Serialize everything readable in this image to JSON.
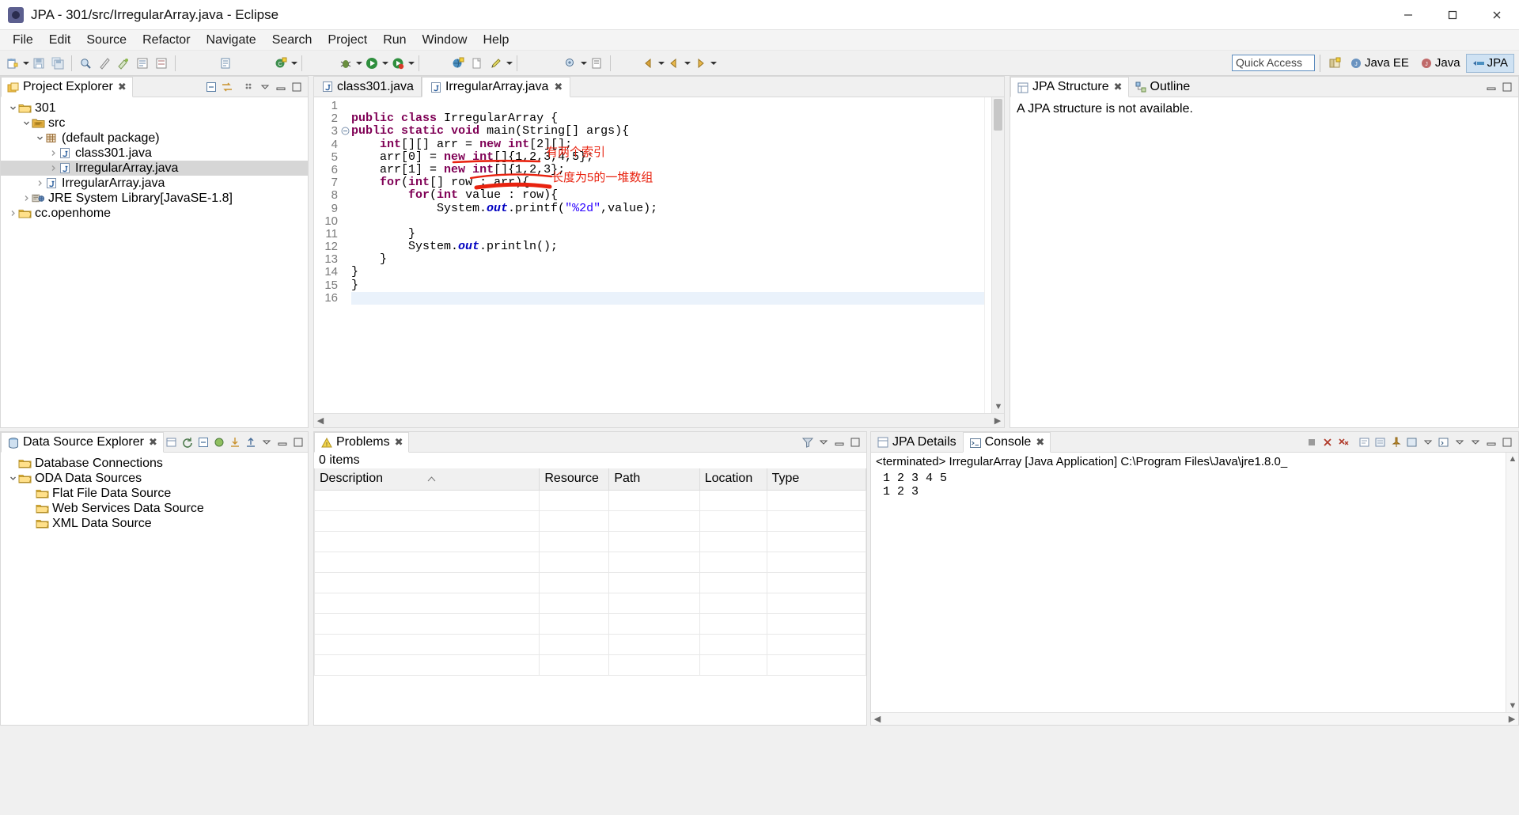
{
  "window": {
    "title": "JPA - 301/src/IrregularArray.java - Eclipse",
    "icon": "eclipse-icon",
    "controls": {
      "minimize": "—",
      "maximize": "❐",
      "close": "✕"
    }
  },
  "menu": [
    "File",
    "Edit",
    "Source",
    "Refactor",
    "Navigate",
    "Search",
    "Project",
    "Run",
    "Window",
    "Help"
  ],
  "toolbar": {
    "quick_access_placeholder": "Quick Access",
    "quick_access_value": "Quick Access",
    "perspectives": [
      {
        "label": "Java EE",
        "icon": "java-ee-perspective-icon",
        "active": false
      },
      {
        "label": "Java",
        "icon": "java-perspective-icon",
        "active": false
      },
      {
        "label": "JPA",
        "icon": "jpa-perspective-icon",
        "active": true
      }
    ],
    "open_perspective_icon": "open-perspective-icon"
  },
  "project_explorer": {
    "tab_label": "Project Explorer",
    "tab_icon": "project-explorer-icon",
    "tools": [
      "collapse-all-icon",
      "link-with-editor-icon",
      "view-menu-icon",
      "minimize-icon",
      "maximize-icon"
    ],
    "tree": [
      {
        "label": "301",
        "icon": "project-icon",
        "indent": 0,
        "expanded": true,
        "has_arrow": true,
        "selected": false
      },
      {
        "label": "src",
        "icon": "source-folder-icon",
        "indent": 1,
        "expanded": true,
        "has_arrow": true,
        "selected": false
      },
      {
        "label": "(default package)",
        "icon": "package-icon",
        "indent": 2,
        "expanded": true,
        "has_arrow": true,
        "selected": false
      },
      {
        "label": "class301.java",
        "icon": "java-file-icon",
        "indent": 3,
        "expanded": false,
        "has_arrow": true,
        "selected": false
      },
      {
        "label": "IrregularArray.java",
        "icon": "java-file-icon",
        "indent": 3,
        "expanded": false,
        "has_arrow": true,
        "selected": true
      },
      {
        "label": "IrregularArray.java",
        "icon": "java-file-icon",
        "indent": 2,
        "expanded": false,
        "has_arrow": true,
        "selected": false
      },
      {
        "label": "JRE System Library",
        "suffix": " [JavaSE-1.8]",
        "icon": "library-icon",
        "indent": 1,
        "expanded": false,
        "has_arrow": true,
        "selected": false
      },
      {
        "label": "cc.openhome",
        "icon": "project-icon",
        "indent": 0,
        "expanded": false,
        "has_arrow": true,
        "selected": false
      }
    ]
  },
  "editor": {
    "tabs": [
      {
        "label": "class301.java",
        "icon": "java-file-icon",
        "active": false,
        "closable": false
      },
      {
        "label": "IrregularArray.java",
        "icon": "java-file-icon",
        "active": true,
        "closable": true
      }
    ],
    "current_line": 16,
    "lines": [
      {
        "n": 1,
        "tokens": []
      },
      {
        "n": 2,
        "tokens": [
          {
            "t": "public",
            "c": "kw"
          },
          {
            "t": " ",
            "c": ""
          },
          {
            "t": "class",
            "c": "kw"
          },
          {
            "t": " IrregularArray {",
            "c": ""
          }
        ]
      },
      {
        "n": 3,
        "fold": true,
        "tokens": [
          {
            "t": "public",
            "c": "kw"
          },
          {
            "t": " ",
            "c": ""
          },
          {
            "t": "static",
            "c": "kw"
          },
          {
            "t": " ",
            "c": ""
          },
          {
            "t": "void",
            "c": "kw"
          },
          {
            "t": " main(String[] args){",
            "c": ""
          }
        ]
      },
      {
        "n": 4,
        "tokens": [
          {
            "t": "    ",
            "c": ""
          },
          {
            "t": "int",
            "c": "kw"
          },
          {
            "t": "[][] arr = ",
            "c": ""
          },
          {
            "t": "new",
            "c": "kw"
          },
          {
            "t": " ",
            "c": ""
          },
          {
            "t": "int",
            "c": "kw"
          },
          {
            "t": "[2][];",
            "c": ""
          }
        ]
      },
      {
        "n": 5,
        "tokens": [
          {
            "t": "    arr[0] = ",
            "c": ""
          },
          {
            "t": "new",
            "c": "kw"
          },
          {
            "t": " ",
            "c": ""
          },
          {
            "t": "int",
            "c": "kw"
          },
          {
            "t": "[]{1,2,3,4,5};",
            "c": ""
          }
        ]
      },
      {
        "n": 6,
        "tokens": [
          {
            "t": "    arr[1] = ",
            "c": ""
          },
          {
            "t": "new",
            "c": "kw"
          },
          {
            "t": " ",
            "c": ""
          },
          {
            "t": "int",
            "c": "kw"
          },
          {
            "t": "[]{1,2,3};",
            "c": ""
          }
        ]
      },
      {
        "n": 7,
        "tokens": [
          {
            "t": "    ",
            "c": ""
          },
          {
            "t": "for",
            "c": "kw"
          },
          {
            "t": "(",
            "c": ""
          },
          {
            "t": "int",
            "c": "kw"
          },
          {
            "t": "[] row : arr){",
            "c": ""
          }
        ]
      },
      {
        "n": 8,
        "tokens": [
          {
            "t": "        ",
            "c": ""
          },
          {
            "t": "for",
            "c": "kw"
          },
          {
            "t": "(",
            "c": ""
          },
          {
            "t": "int",
            "c": "kw"
          },
          {
            "t": " value : row){",
            "c": ""
          }
        ]
      },
      {
        "n": 9,
        "tokens": [
          {
            "t": "            System.",
            "c": ""
          },
          {
            "t": "out",
            "c": "fld"
          },
          {
            "t": ".printf(",
            "c": ""
          },
          {
            "t": "\"%2d\"",
            "c": "str"
          },
          {
            "t": ",value);",
            "c": ""
          }
        ]
      },
      {
        "n": 10,
        "tokens": []
      },
      {
        "n": 11,
        "tokens": [
          {
            "t": "        }",
            "c": ""
          }
        ]
      },
      {
        "n": 12,
        "tokens": [
          {
            "t": "        System.",
            "c": ""
          },
          {
            "t": "out",
            "c": "fld"
          },
          {
            "t": ".println();",
            "c": ""
          }
        ]
      },
      {
        "n": 13,
        "tokens": [
          {
            "t": "    }",
            "c": ""
          }
        ]
      },
      {
        "n": 14,
        "tokens": [
          {
            "t": "}",
            "c": ""
          }
        ]
      },
      {
        "n": 15,
        "tokens": [
          {
            "t": "}",
            "c": ""
          }
        ]
      },
      {
        "n": 16,
        "tokens": []
      }
    ],
    "annotations": [
      {
        "name": "annotation-two-indexes",
        "text": "有两个索引",
        "color": "#e8220f"
      },
      {
        "name": "annotation-length-five",
        "text": "长度为5的一堆数组",
        "color": "#e8220f"
      }
    ]
  },
  "jpa_structure": {
    "tabs": [
      {
        "label": "JPA Structure",
        "icon": "jpa-structure-icon",
        "active": true,
        "closable": true
      },
      {
        "label": "Outline",
        "icon": "outline-icon",
        "active": false,
        "closable": false
      }
    ],
    "message": "A JPA structure is not available."
  },
  "data_source_explorer": {
    "tab_label": "Data Source Explorer",
    "tab_icon": "data-source-explorer-icon",
    "tree": [
      {
        "label": "Database Connections",
        "indent": 0,
        "has_arrow": false,
        "expanded": false
      },
      {
        "label": "ODA Data Sources",
        "indent": 0,
        "has_arrow": true,
        "expanded": true
      },
      {
        "label": "Flat File Data Source",
        "indent": 1,
        "has_arrow": false,
        "expanded": false
      },
      {
        "label": "Web Services Data Source",
        "indent": 1,
        "has_arrow": false,
        "expanded": false
      },
      {
        "label": "XML Data Source",
        "indent": 1,
        "has_arrow": false,
        "expanded": false
      }
    ]
  },
  "problems": {
    "tab_label": "Problems",
    "tab_icon": "problems-icon",
    "item_count_text": "0 items",
    "columns": [
      "Description",
      "Resource",
      "Path",
      "Location",
      "Type"
    ],
    "rows": []
  },
  "console": {
    "tabs": [
      {
        "label": "JPA Details",
        "icon": "jpa-details-icon",
        "active": false,
        "closable": false
      },
      {
        "label": "Console",
        "icon": "console-icon",
        "active": true,
        "closable": true
      }
    ],
    "status_line": "<terminated> IrregularArray [Java Application] C:\\Program Files\\Java\\jre1.8.0_",
    "output": " 1 2 3 4 5\n 1 2 3",
    "tools": [
      "terminate-icon",
      "remove-launch-icon",
      "remove-all-icon",
      "clear-console-icon",
      "scroll-lock-icon",
      "pin-console-icon",
      "display-console-icon",
      "open-console-icon",
      "view-menu-icon",
      "minimize-icon",
      "maximize-icon"
    ]
  },
  "colors": {
    "accent": "#cfe2f3",
    "keyword": "#7f0055",
    "string": "#2a00ff",
    "field": "#0000c0",
    "annotation_red": "#e8220f",
    "selection": "#d6d6d6"
  }
}
